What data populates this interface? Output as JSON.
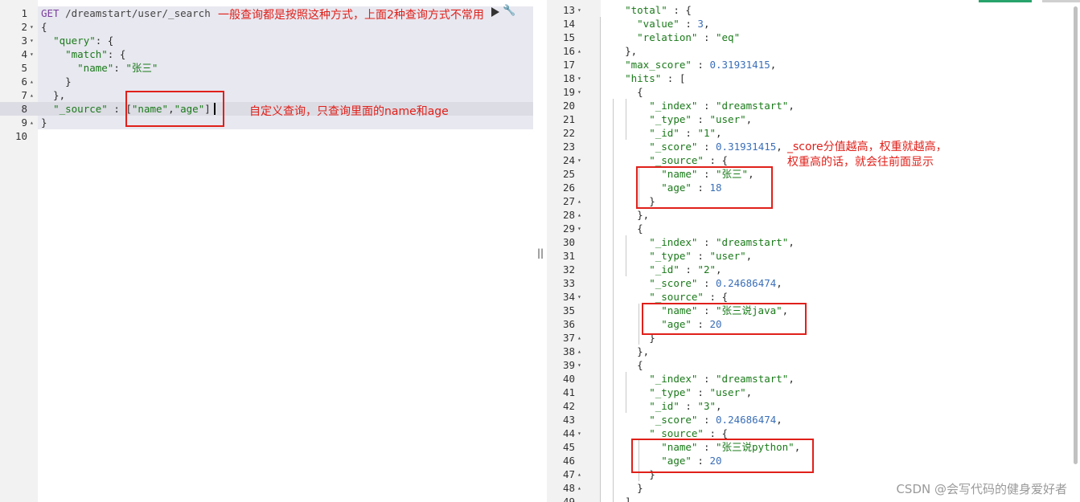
{
  "colors": {
    "annotation": "#e0201a",
    "keyword": "#7a3e9d",
    "string": "#1a7a1a",
    "number": "#3a6fb8"
  },
  "left_editor": {
    "lines": [
      {
        "n": "1",
        "fold": "",
        "parts": [
          [
            "k",
            "GET "
          ],
          [
            "u",
            "/dreamstart/user/_search"
          ]
        ]
      },
      {
        "n": "2",
        "fold": "▾",
        "parts": [
          [
            "p",
            "{"
          ]
        ]
      },
      {
        "n": "3",
        "fold": "▾",
        "parts": [
          [
            "p",
            "  "
          ],
          [
            "s",
            "\"query\""
          ],
          [
            "p",
            ": {"
          ]
        ]
      },
      {
        "n": "4",
        "fold": "▾",
        "parts": [
          [
            "p",
            "    "
          ],
          [
            "s",
            "\"match\""
          ],
          [
            "p",
            ": {"
          ]
        ]
      },
      {
        "n": "5",
        "fold": "",
        "parts": [
          [
            "p",
            "      "
          ],
          [
            "s",
            "\"name\""
          ],
          [
            "p",
            ": "
          ],
          [
            "s",
            "\"张三\""
          ]
        ]
      },
      {
        "n": "6",
        "fold": "▴",
        "parts": [
          [
            "p",
            "    }"
          ]
        ]
      },
      {
        "n": "7",
        "fold": "▴",
        "parts": [
          [
            "p",
            "  },"
          ]
        ]
      },
      {
        "n": "8",
        "fold": "",
        "parts": [
          [
            "p",
            "  "
          ],
          [
            "s",
            "\"_source\""
          ],
          [
            "p",
            " : ["
          ],
          [
            "s",
            "\"name\""
          ],
          [
            "p",
            ","
          ],
          [
            "s",
            "\"age\""
          ],
          [
            "p",
            "]"
          ]
        ]
      },
      {
        "n": "9",
        "fold": "▴",
        "parts": [
          [
            "p",
            "}"
          ]
        ]
      },
      {
        "n": "10",
        "fold": "",
        "parts": []
      }
    ]
  },
  "right_editor": {
    "lines": [
      {
        "n": "13",
        "fold": "▾",
        "parts": [
          [
            "p",
            "    "
          ],
          [
            "s",
            "\"total\""
          ],
          [
            "p",
            " : {"
          ]
        ]
      },
      {
        "n": "14",
        "fold": "",
        "parts": [
          [
            "p",
            "      "
          ],
          [
            "s",
            "\"value\""
          ],
          [
            "p",
            " : "
          ],
          [
            "n",
            "3"
          ],
          [
            "p",
            ","
          ]
        ]
      },
      {
        "n": "15",
        "fold": "",
        "parts": [
          [
            "p",
            "      "
          ],
          [
            "s",
            "\"relation\""
          ],
          [
            "p",
            " : "
          ],
          [
            "s",
            "\"eq\""
          ]
        ]
      },
      {
        "n": "16",
        "fold": "▴",
        "parts": [
          [
            "p",
            "    },"
          ]
        ]
      },
      {
        "n": "17",
        "fold": "",
        "parts": [
          [
            "p",
            "    "
          ],
          [
            "s",
            "\"max_score\""
          ],
          [
            "p",
            " : "
          ],
          [
            "n",
            "0.31931415"
          ],
          [
            "p",
            ","
          ]
        ]
      },
      {
        "n": "18",
        "fold": "▾",
        "parts": [
          [
            "p",
            "    "
          ],
          [
            "s",
            "\"hits\""
          ],
          [
            "p",
            " : ["
          ]
        ]
      },
      {
        "n": "19",
        "fold": "▾",
        "parts": [
          [
            "p",
            "      {"
          ]
        ]
      },
      {
        "n": "20",
        "fold": "",
        "parts": [
          [
            "p",
            "        "
          ],
          [
            "s",
            "\"_index\""
          ],
          [
            "p",
            " : "
          ],
          [
            "s",
            "\"dreamstart\""
          ],
          [
            "p",
            ","
          ]
        ]
      },
      {
        "n": "21",
        "fold": "",
        "parts": [
          [
            "p",
            "        "
          ],
          [
            "s",
            "\"_type\""
          ],
          [
            "p",
            " : "
          ],
          [
            "s",
            "\"user\""
          ],
          [
            "p",
            ","
          ]
        ]
      },
      {
        "n": "22",
        "fold": "",
        "parts": [
          [
            "p",
            "        "
          ],
          [
            "s",
            "\"_id\""
          ],
          [
            "p",
            " : "
          ],
          [
            "s",
            "\"1\""
          ],
          [
            "p",
            ","
          ]
        ]
      },
      {
        "n": "23",
        "fold": "",
        "parts": [
          [
            "p",
            "        "
          ],
          [
            "s",
            "\"_score\""
          ],
          [
            "p",
            " : "
          ],
          [
            "n",
            "0.31931415"
          ],
          [
            "p",
            ","
          ]
        ]
      },
      {
        "n": "24",
        "fold": "▾",
        "parts": [
          [
            "p",
            "        "
          ],
          [
            "s",
            "\"_source\""
          ],
          [
            "p",
            " : {"
          ]
        ]
      },
      {
        "n": "25",
        "fold": "",
        "parts": [
          [
            "p",
            "          "
          ],
          [
            "s",
            "\"name\""
          ],
          [
            "p",
            " : "
          ],
          [
            "s",
            "\"张三\""
          ],
          [
            "p",
            ","
          ]
        ]
      },
      {
        "n": "26",
        "fold": "",
        "parts": [
          [
            "p",
            "          "
          ],
          [
            "s",
            "\"age\""
          ],
          [
            "p",
            " : "
          ],
          [
            "n",
            "18"
          ]
        ]
      },
      {
        "n": "27",
        "fold": "▴",
        "parts": [
          [
            "p",
            "        }"
          ]
        ]
      },
      {
        "n": "28",
        "fold": "▴",
        "parts": [
          [
            "p",
            "      },"
          ]
        ]
      },
      {
        "n": "29",
        "fold": "▾",
        "parts": [
          [
            "p",
            "      {"
          ]
        ]
      },
      {
        "n": "30",
        "fold": "",
        "parts": [
          [
            "p",
            "        "
          ],
          [
            "s",
            "\"_index\""
          ],
          [
            "p",
            " : "
          ],
          [
            "s",
            "\"dreamstart\""
          ],
          [
            "p",
            ","
          ]
        ]
      },
      {
        "n": "31",
        "fold": "",
        "parts": [
          [
            "p",
            "        "
          ],
          [
            "s",
            "\"_type\""
          ],
          [
            "p",
            " : "
          ],
          [
            "s",
            "\"user\""
          ],
          [
            "p",
            ","
          ]
        ]
      },
      {
        "n": "32",
        "fold": "",
        "parts": [
          [
            "p",
            "        "
          ],
          [
            "s",
            "\"_id\""
          ],
          [
            "p",
            " : "
          ],
          [
            "s",
            "\"2\""
          ],
          [
            "p",
            ","
          ]
        ]
      },
      {
        "n": "33",
        "fold": "",
        "parts": [
          [
            "p",
            "        "
          ],
          [
            "s",
            "\"_score\""
          ],
          [
            "p",
            " : "
          ],
          [
            "n",
            "0.24686474"
          ],
          [
            "p",
            ","
          ]
        ]
      },
      {
        "n": "34",
        "fold": "▾",
        "parts": [
          [
            "p",
            "        "
          ],
          [
            "s",
            "\"_source\""
          ],
          [
            "p",
            " : {"
          ]
        ]
      },
      {
        "n": "35",
        "fold": "",
        "parts": [
          [
            "p",
            "          "
          ],
          [
            "s",
            "\"name\""
          ],
          [
            "p",
            " : "
          ],
          [
            "s",
            "\"张三说java\""
          ],
          [
            "p",
            ","
          ]
        ]
      },
      {
        "n": "36",
        "fold": "",
        "parts": [
          [
            "p",
            "          "
          ],
          [
            "s",
            "\"age\""
          ],
          [
            "p",
            " : "
          ],
          [
            "n",
            "20"
          ]
        ]
      },
      {
        "n": "37",
        "fold": "▴",
        "parts": [
          [
            "p",
            "        }"
          ]
        ]
      },
      {
        "n": "38",
        "fold": "▴",
        "parts": [
          [
            "p",
            "      },"
          ]
        ]
      },
      {
        "n": "39",
        "fold": "▾",
        "parts": [
          [
            "p",
            "      {"
          ]
        ]
      },
      {
        "n": "40",
        "fold": "",
        "parts": [
          [
            "p",
            "        "
          ],
          [
            "s",
            "\"_index\""
          ],
          [
            "p",
            " : "
          ],
          [
            "s",
            "\"dreamstart\""
          ],
          [
            "p",
            ","
          ]
        ]
      },
      {
        "n": "41",
        "fold": "",
        "parts": [
          [
            "p",
            "        "
          ],
          [
            "s",
            "\"_type\""
          ],
          [
            "p",
            " : "
          ],
          [
            "s",
            "\"user\""
          ],
          [
            "p",
            ","
          ]
        ]
      },
      {
        "n": "42",
        "fold": "",
        "parts": [
          [
            "p",
            "        "
          ],
          [
            "s",
            "\"_id\""
          ],
          [
            "p",
            " : "
          ],
          [
            "s",
            "\"3\""
          ],
          [
            "p",
            ","
          ]
        ]
      },
      {
        "n": "43",
        "fold": "",
        "parts": [
          [
            "p",
            "        "
          ],
          [
            "s",
            "\"_score\""
          ],
          [
            "p",
            " : "
          ],
          [
            "n",
            "0.24686474"
          ],
          [
            "p",
            ","
          ]
        ]
      },
      {
        "n": "44",
        "fold": "▾",
        "parts": [
          [
            "p",
            "        "
          ],
          [
            "s",
            "\"_source\""
          ],
          [
            "p",
            " : {"
          ]
        ]
      },
      {
        "n": "45",
        "fold": "",
        "parts": [
          [
            "p",
            "          "
          ],
          [
            "s",
            "\"name\""
          ],
          [
            "p",
            " : "
          ],
          [
            "s",
            "\"张三说python\""
          ],
          [
            "p",
            ","
          ]
        ]
      },
      {
        "n": "46",
        "fold": "",
        "parts": [
          [
            "p",
            "          "
          ],
          [
            "s",
            "\"age\""
          ],
          [
            "p",
            " : "
          ],
          [
            "n",
            "20"
          ]
        ]
      },
      {
        "n": "47",
        "fold": "▴",
        "parts": [
          [
            "p",
            "        }"
          ]
        ]
      },
      {
        "n": "48",
        "fold": "▴",
        "parts": [
          [
            "p",
            "      }"
          ]
        ]
      },
      {
        "n": "49",
        "fold": "",
        "parts": [
          [
            "p",
            "    ]"
          ]
        ]
      }
    ]
  },
  "annotations": {
    "top_note": "一般查询都是按照这种方式，上面2种查询方式不常用",
    "source_note": "自定义查询，只查询里面的name和age",
    "score_note_1": "_score分值越高，权重就越高，",
    "score_note_2": "权重高的话，就会往前面显示"
  },
  "toolbar": {
    "run_icon": "play-icon",
    "settings_icon": "wrench-icon"
  },
  "resize_glyph": "||",
  "watermark": "CSDN @会写代码的健身爱好者"
}
